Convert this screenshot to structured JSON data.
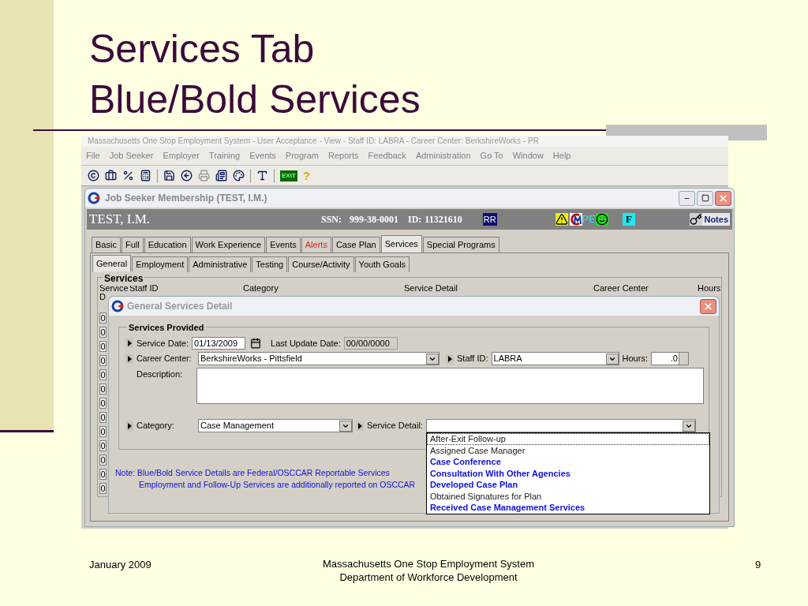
{
  "slide": {
    "title_lines": [
      "Services Tab",
      "Blue/Bold Services"
    ],
    "footer": {
      "date": "January 2009",
      "center_lines": [
        "Massachusetts One Stop Employment System",
        "Department of Workforce Development"
      ],
      "page": "9"
    }
  },
  "app": {
    "title": "Massachusetts One Stop Employment System - User Acceptance - View - Staff ID: LABRA - Career Center: BerkshireWorks - PR",
    "menu": [
      "File",
      "Job Seeker",
      "Employer",
      "Training",
      "Events",
      "Program",
      "Reports",
      "Feedback",
      "Administration",
      "Go To",
      "Window",
      "Help"
    ],
    "toolbar": {
      "exit_label": "EXIT",
      "help_label": "?"
    }
  },
  "window": {
    "title": "Job Seeker Membership (TEST, I.M.)",
    "header": {
      "name": "TEST, I.M.",
      "ssn_label": "SSN:",
      "ssn": "999-38-0001",
      "id_label": "ID:",
      "id": "11321610",
      "rr_badge": "RR",
      "pe_label": "PE",
      "f_badge": "F",
      "notes_button": "Notes"
    }
  },
  "tabs": [
    {
      "label": "Basic",
      "selected": false,
      "kind": "normal"
    },
    {
      "label": "Full",
      "selected": false,
      "kind": "normal"
    },
    {
      "label": "Education",
      "selected": false,
      "kind": "normal"
    },
    {
      "label": "Work Experience",
      "selected": false,
      "kind": "normal"
    },
    {
      "label": "Events",
      "selected": false,
      "kind": "normal"
    },
    {
      "label": "Alerts",
      "selected": false,
      "kind": "alert"
    },
    {
      "label": "Case Plan",
      "selected": false,
      "kind": "normal"
    },
    {
      "label": "Services",
      "selected": true,
      "kind": "normal"
    },
    {
      "label": "Special Programs",
      "selected": false,
      "kind": "normal"
    }
  ],
  "subtabs": [
    {
      "label": "General",
      "selected": true
    },
    {
      "label": "Employment",
      "selected": false
    },
    {
      "label": "Administrative",
      "selected": false
    },
    {
      "label": "Testing",
      "selected": false
    },
    {
      "label": "Course/Activity",
      "selected": false
    },
    {
      "label": "Youth Goals",
      "selected": false
    }
  ],
  "services": {
    "title": "Services",
    "columns": [
      "Service D",
      "Staff ID",
      "Category",
      "Service Detail",
      "Career Center",
      "Hours"
    ],
    "row_values": [
      "0",
      "0",
      "0",
      "0",
      "0",
      "0",
      "0",
      "0",
      "0",
      "0",
      "0",
      "0",
      "0"
    ]
  },
  "dialog": {
    "title": "General Services Detail",
    "group_title": "Services Provided",
    "service_date_label": "Service Date:",
    "service_date": "01/13/2009",
    "last_update_label": "Last Update Date:",
    "last_update": "00/00/0000",
    "career_center_label": "Career Center:",
    "career_center": "BerkshireWorks - Pittsfield",
    "staff_id_label": "Staff ID:",
    "staff_id": "LABRA",
    "hours_label": "Hours:",
    "hours": ".0",
    "description_label": "Description:",
    "category_label": "Category:",
    "category": "Case Management",
    "service_detail_label": "Service Detail:",
    "note_lines": [
      "Note: Blue/Bold Service Details are Federal/OSCCAR Reportable Services",
      "Employment and Follow-Up Services are additionally reported on OSCCAR"
    ],
    "options": [
      {
        "label": "After-Exit Follow-up",
        "reportable": false,
        "selected": true
      },
      {
        "label": "Assigned Case Manager",
        "reportable": false,
        "selected": false
      },
      {
        "label": "Case Conference",
        "reportable": true,
        "selected": false
      },
      {
        "label": "Consultation With Other Agencies",
        "reportable": true,
        "selected": false
      },
      {
        "label": "Developed Case Plan",
        "reportable": true,
        "selected": false
      },
      {
        "label": "Obtained Signatures for Plan",
        "reportable": false,
        "selected": false
      },
      {
        "label": "Received Case Management Services",
        "reportable": true,
        "selected": false
      }
    ]
  }
}
